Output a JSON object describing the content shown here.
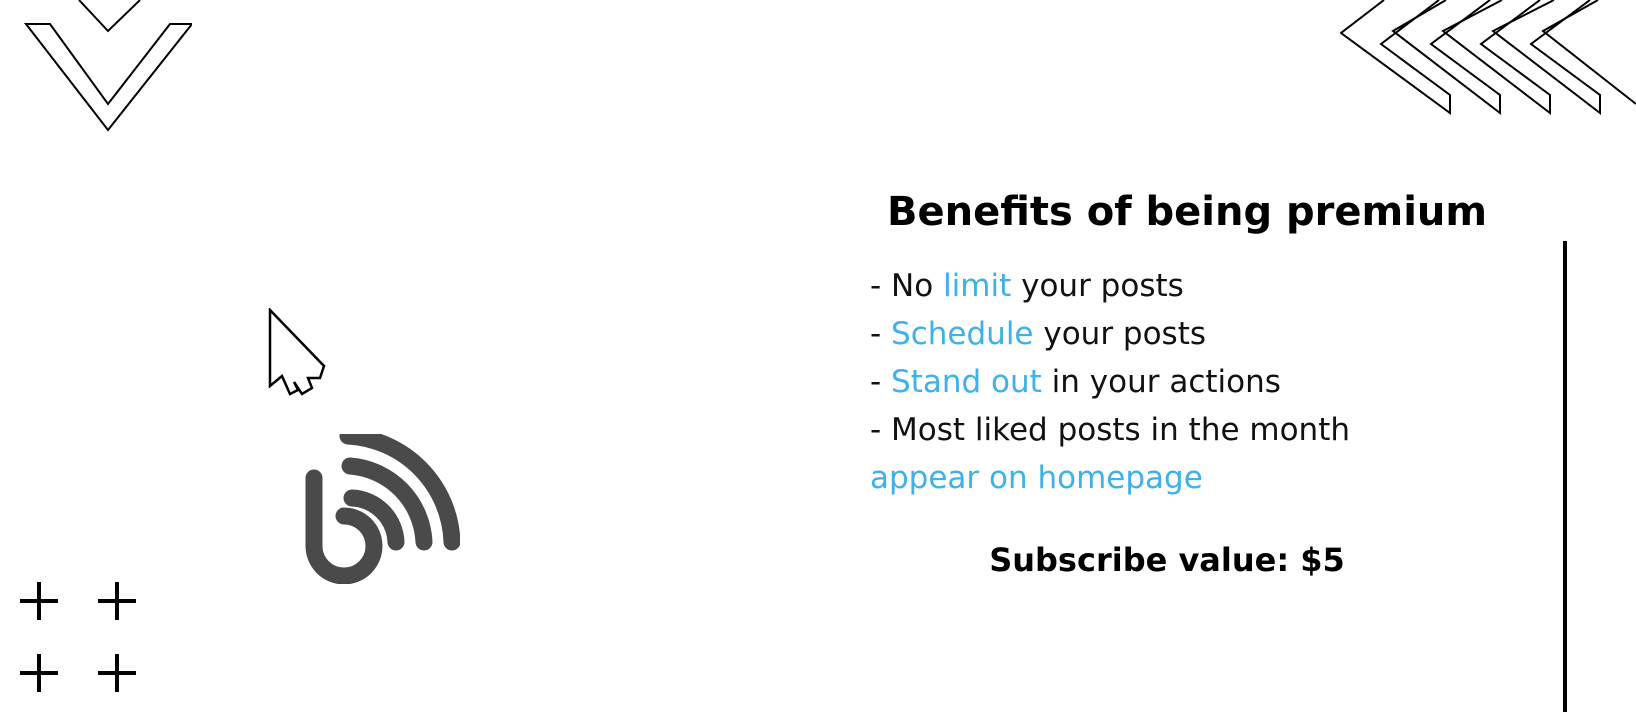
{
  "benefits_panel": {
    "title": "Benefits of being premium",
    "items": [
      {
        "prefix": "- No ",
        "highlight": "limit",
        "suffix": " your posts"
      },
      {
        "prefix": "- ",
        "highlight": "Schedule",
        "suffix": " your posts"
      },
      {
        "prefix": "- ",
        "highlight": "Stand out",
        "suffix": " in your actions"
      },
      {
        "prefix": "- Most liked posts in the month",
        "highlight": "",
        "suffix": ""
      },
      {
        "prefix": "",
        "highlight": "appear on homepage",
        "suffix": ""
      }
    ],
    "subscribe_label": "Subscribe value: $5"
  },
  "colors": {
    "highlight": "#3eb0ea",
    "logo": "#4a4a4a",
    "text": "#111111",
    "background": "#ffffff"
  },
  "icons": {
    "cursor": "hand-pointer-icon",
    "logo": "blog-feed-logo-icon",
    "top_left": "chevron-down-outline-icon",
    "top_right": "chevron-left-outline-icon",
    "plus": "plus-icon"
  }
}
